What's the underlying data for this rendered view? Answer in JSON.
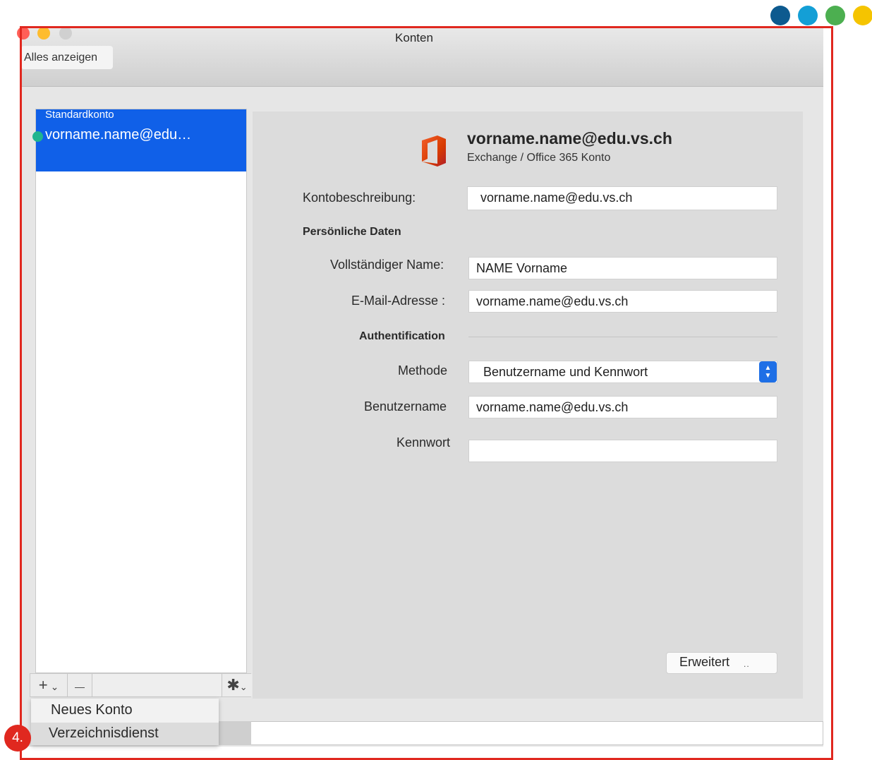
{
  "brand_colors": [
    "#0d5a8f",
    "#149fd6",
    "#4caf50",
    "#f5c400"
  ],
  "window": {
    "title": "Konten",
    "show_all_label": "Alles anzeigen",
    "traffic_colors": [
      "#ff5f57",
      "#febc2e",
      "#d0d0d0"
    ]
  },
  "sidebar": {
    "default_label": "Standardkonto",
    "account_email": "vorname.name@edu…",
    "status_color": "#20b58e",
    "selection_color": "#1060e8"
  },
  "toolbar": {
    "add_label": "+",
    "add_chevron": "⌄",
    "remove_label": "—",
    "gear_icon": "✱",
    "gear_chevron": "⌄"
  },
  "add_menu": {
    "items": [
      "Neues Konto",
      "Verzeichnisdienst"
    ]
  },
  "account": {
    "logo": "office-logo-icon",
    "email": "vorname.name@edu.vs.ch",
    "type": "Exchange / Office 365 Konto"
  },
  "form": {
    "description_label": "Kontobeschreibung:",
    "description_value": "vorname.name@edu.vs.ch",
    "personal_heading": "Persönliche Daten",
    "fullname_label": "Vollständiger Name:",
    "fullname_value": "NAME Vorname",
    "email_label": "E-Mail-Adresse :",
    "email_value": "vorname.name@edu.vs.ch",
    "auth_heading": "Authentification",
    "method_label": "Methode",
    "method_value": "Benutzername und Kennwort",
    "username_label": "Benutzername",
    "username_value": "vorname.name@edu.vs.ch",
    "password_label": "Kennwort",
    "password_value": "",
    "advanced_label": "Erweitert",
    "advanced_dots": ".."
  },
  "annotation": {
    "step_number": "4.",
    "highlight_color": "#e0281f"
  }
}
